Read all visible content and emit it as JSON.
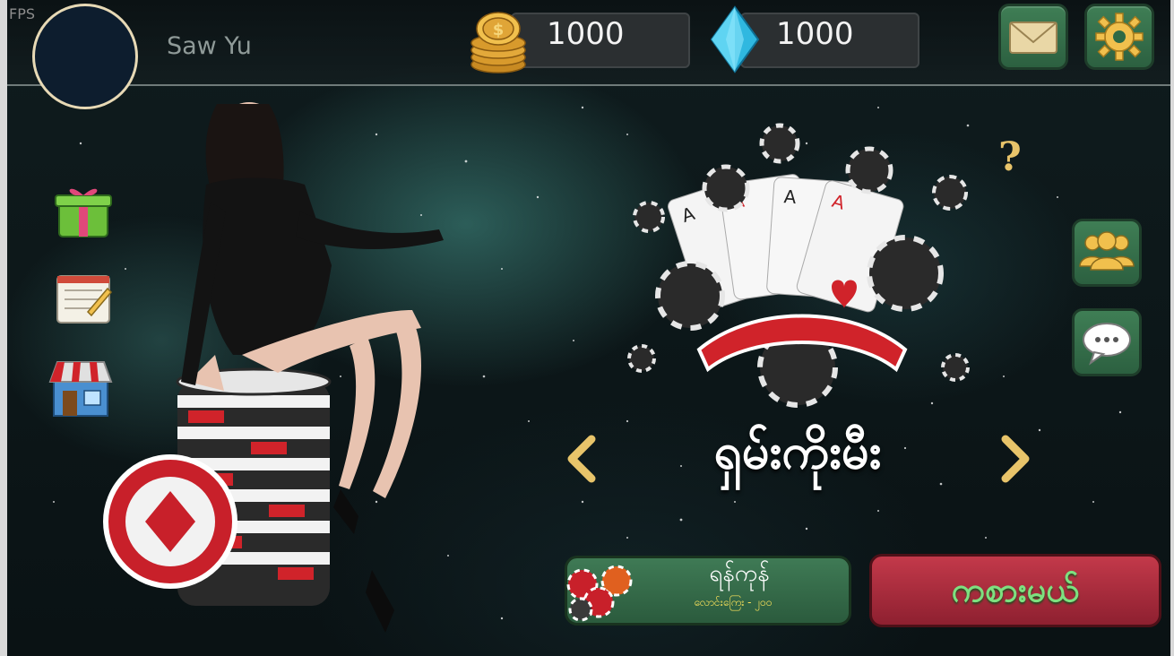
{
  "hud": {
    "fps_label": "FPS",
    "player_name": "Saw Yu",
    "coins": "1000",
    "gems": "1000"
  },
  "game": {
    "title": "ရှမ်းကိုးမီး"
  },
  "buttons": {
    "quick_join_label": "ရန်ကုန်",
    "quick_join_sub": "လောင်းကြေး - ၂၀၀",
    "play_label": "ကစားမယ်"
  },
  "help_glyph": "?",
  "colors": {
    "button_green": "#3f7a55",
    "button_red": "#c3394a",
    "accent_gold": "#e8c46a",
    "gem_cyan": "#34c3e6"
  },
  "icons": [
    "gift-icon",
    "notepad-icon",
    "shop-icon",
    "mail-icon",
    "settings-icon",
    "friends-icon",
    "chat-icon",
    "coin-icon",
    "gem-icon",
    "arrow-left-icon",
    "arrow-right-icon"
  ]
}
